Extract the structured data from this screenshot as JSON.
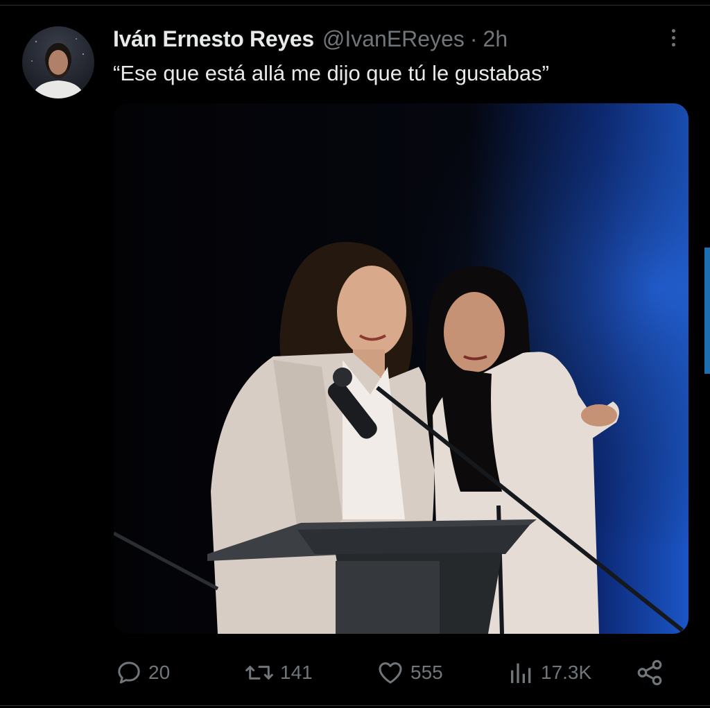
{
  "tweet": {
    "author": {
      "display_name": "Iván Ernesto Reyes",
      "handle": "@IvanEReyes",
      "separator": "·",
      "time": "2h"
    },
    "text": "“Ese que está allá me dijo que tú le gustabas”"
  },
  "actions": {
    "reply_count": "20",
    "retweet_count": "141",
    "like_count": "555",
    "views_count": "17.3K"
  },
  "icons": {
    "reply": "comment-bubble-icon",
    "retweet": "retweet-icon",
    "like": "heart-icon",
    "views": "views-bar-chart-icon",
    "share": "share-icon",
    "more": "more-vertical-icon"
  },
  "colors": {
    "background": "#000000",
    "primary_text": "#e7e9ea",
    "secondary_text": "#71767b",
    "divider": "#2f3336",
    "scroll_accent": "#1d6fb0"
  }
}
